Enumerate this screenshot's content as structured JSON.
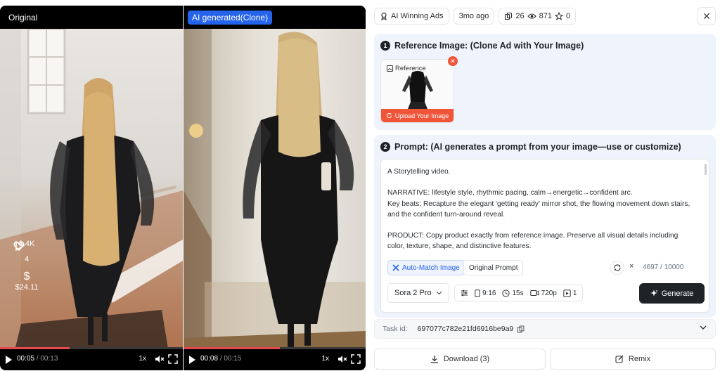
{
  "videos": {
    "original": {
      "label": "Original",
      "current_time": "00:05",
      "duration": "/ 00:13",
      "speed": "1x",
      "progress": 0.38,
      "stats": {
        "plays": "3.4K",
        "likes": "4",
        "revenue": "$24.11"
      }
    },
    "clone": {
      "label": "AI generated(Clone)",
      "current_time": "00:08",
      "duration": "/ 00:15",
      "speed": "1x",
      "progress": 0.53
    }
  },
  "meta": {
    "source": "AI Winning Ads",
    "age": "3mo ago",
    "copies": "26",
    "views": "871",
    "stars": "0"
  },
  "reference": {
    "title": "Reference Image: (Clone Ad with Your Image)",
    "step": "1",
    "ref_label": "Reference",
    "upload_label": "Upload Your Image"
  },
  "prompt": {
    "title": "Prompt: (AI generates a prompt from your image—use or customize)",
    "step": "2",
    "text": "A Storytelling video.\n\nNARRATIVE: lifestyle style, rhythmic pacing, calm→energetic→confident arc.\nKey beats: Recapture the elegant 'getting ready' mirror shot, the flowing movement down stairs, and the confident turn-around reveal.\n\nPRODUCT: Copy product exactly from reference image. Preserve all visual details including color, texture, shape, and distinctive features.",
    "auto_match": "Auto-Match Image",
    "original_prompt": "Original Prompt",
    "char_count": "4697 / 10000",
    "clear": "×"
  },
  "settings": {
    "model": "Sora 2 Pro",
    "aspect": "9:16",
    "duration": "15s",
    "resolution": "720p",
    "count": "1",
    "generate": "Generate"
  },
  "task": {
    "label": "Task id:",
    "id": "697077c782e21fd6916be9a9"
  },
  "actions": {
    "download": "Download (3)",
    "remix": "Remix"
  },
  "colors": {
    "accent": "#2563eb",
    "upload": "#f0553a",
    "card_bg": "#eef3fc",
    "dark": "#1f2328"
  }
}
